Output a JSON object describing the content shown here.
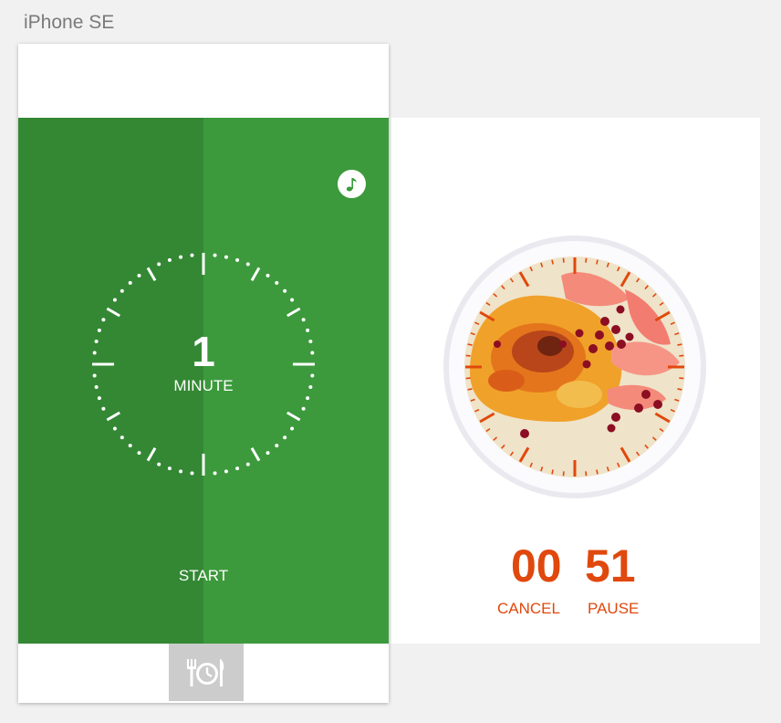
{
  "device": {
    "label": "iPhone SE"
  },
  "timer_screen": {
    "number": "1",
    "unit": "MINUTE",
    "start_label": "START",
    "music_icon": "music-note-icon",
    "tab_icon": "dining-timer-icon",
    "colors": {
      "panel": "#3c9a3c",
      "panel_shade": "#348834",
      "text": "#ffffff"
    }
  },
  "running_screen": {
    "minutes": "00",
    "seconds": "51",
    "cancel_label": "CANCEL",
    "pause_label": "PAUSE",
    "accent_color": "#e0480d",
    "dish_image": "creme-brulee-with-grapefruit-and-pomegranate"
  }
}
